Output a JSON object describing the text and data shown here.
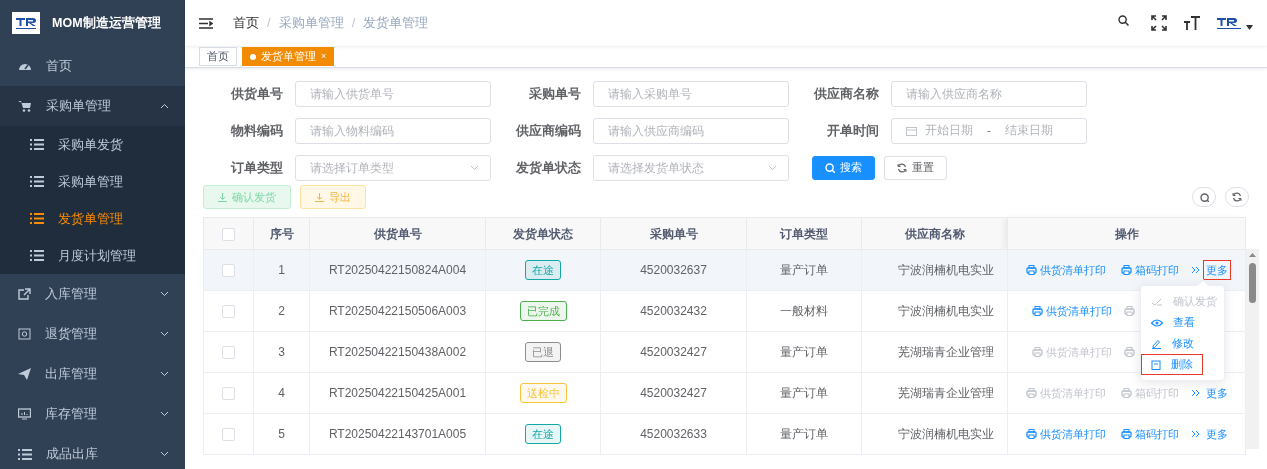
{
  "app": {
    "title": "MOM制造运营管理"
  },
  "sidebar": {
    "items": [
      {
        "kind": "link",
        "label": "首页"
      },
      {
        "kind": "group",
        "label": "采购单管理",
        "expanded": true,
        "children": [
          {
            "label": "采购单发货",
            "selected": false
          },
          {
            "label": "采购单管理",
            "selected": false
          },
          {
            "label": "发货单管理",
            "selected": true
          },
          {
            "label": "月度计划管理",
            "selected": false
          }
        ]
      },
      {
        "kind": "group",
        "label": "入库管理",
        "expanded": false
      },
      {
        "kind": "group",
        "label": "退货管理",
        "expanded": false
      },
      {
        "kind": "group",
        "label": "出库管理",
        "expanded": false
      },
      {
        "kind": "group",
        "label": "库存管理",
        "expanded": false
      },
      {
        "kind": "group",
        "label": "成品出库",
        "expanded": false
      }
    ]
  },
  "breadcrumb": {
    "separator": "/",
    "items": [
      "首页",
      "采购单管理",
      "发货单管理"
    ]
  },
  "tabs": [
    {
      "label": "首页",
      "selected": false
    },
    {
      "label": "发货单管理",
      "selected": true,
      "close": "×"
    }
  ],
  "filters": [
    [
      {
        "kind": "text",
        "label": "供货单号",
        "placeholder": "请输入供货单号"
      },
      {
        "kind": "text",
        "label": "采购单号",
        "placeholder": "请输入采购单号"
      },
      {
        "kind": "text",
        "label": "供应商名称",
        "placeholder": "请输入供应商名称"
      }
    ],
    [
      {
        "kind": "text",
        "label": "物料编码",
        "placeholder": "请输入物料编码"
      },
      {
        "kind": "text",
        "label": "供应商编码",
        "placeholder": "请输入供应商编码"
      },
      {
        "kind": "daterange",
        "label": "开单时间",
        "start_placeholder": "开始日期",
        "separator": "-",
        "end_placeholder": "结束日期"
      }
    ],
    [
      {
        "kind": "select",
        "label": "订单类型",
        "placeholder": "请选择订单类型"
      },
      {
        "kind": "select",
        "label": "发货单状态",
        "placeholder": "请选择发货单状态"
      },
      {
        "kind": "buttons",
        "buttons": [
          {
            "kind": "primary",
            "label": "搜索"
          },
          {
            "kind": "default",
            "label": "重置"
          }
        ]
      }
    ]
  ],
  "toolbar": [
    {
      "kind": "success",
      "label": "确认发货"
    },
    {
      "kind": "warning",
      "label": "导出"
    }
  ],
  "table": {
    "header_checked": false,
    "columns": [
      "序号",
      "供货单号",
      "发货单状态",
      "采购单号",
      "订单类型",
      "供应商名称",
      "操作"
    ],
    "rows": [
      {
        "checked": false,
        "highlighted": true,
        "index": "1",
        "supply_no": "RT20250422150824A004",
        "status": {
          "label": "在途",
          "color": "#13a8a8"
        },
        "po_no": "4520032637",
        "order_type": "量产订单",
        "supplier": "宁波润楠机电实业",
        "actions": [
          {
            "kind": "print",
            "label": "供货清单打印",
            "disabled": false
          },
          {
            "kind": "print",
            "label": "箱码打印",
            "disabled": false
          },
          {
            "kind": "more",
            "label": "更多",
            "disabled": false,
            "highlighted": true
          }
        ]
      },
      {
        "checked": false,
        "highlighted": false,
        "index": "2",
        "supply_no": "RT20250422150506A003",
        "status": {
          "label": "已完成",
          "color": "#4caf50"
        },
        "po_no": "4520032432",
        "order_type": "一般材料",
        "supplier": "宁波润楠机电实业",
        "actions": [
          {
            "kind": "print",
            "label": "供货清单打印",
            "disabled": false
          },
          {
            "kind": "print",
            "disabled": true
          }
        ]
      },
      {
        "checked": false,
        "highlighted": false,
        "index": "3",
        "supply_no": "RT20250422150438A002",
        "status": {
          "label": "已退",
          "color": "#8c8c8c"
        },
        "po_no": "4520032427",
        "order_type": "量产订单",
        "supplier": "芜湖瑞青企业管理",
        "actions": [
          {
            "kind": "print",
            "label": "供货清单打印",
            "disabled": true
          },
          {
            "kind": "print",
            "disabled": true
          }
        ]
      },
      {
        "checked": false,
        "highlighted": false,
        "index": "4",
        "supply_no": "RT20250422150425A001",
        "status": {
          "label": "送检中",
          "color": "#f5c542"
        },
        "po_no": "4520032427",
        "order_type": "量产订单",
        "supplier": "芜湖瑞青企业管理",
        "actions": [
          {
            "kind": "print",
            "label": "供货清单打印",
            "disabled": true
          },
          {
            "kind": "print",
            "label": "箱码打印",
            "disabled": true
          },
          {
            "kind": "more",
            "label": "更多",
            "disabled": false,
            "highlighted": false
          }
        ]
      },
      {
        "checked": false,
        "highlighted": false,
        "index": "5",
        "supply_no": "RT20250422143701A005",
        "status": {
          "label": "在途",
          "color": "#13a8a8"
        },
        "po_no": "4520032633",
        "order_type": "量产订单",
        "supplier": "宁波润楠机电实业",
        "actions": [
          {
            "kind": "print",
            "label": "供货清单打印",
            "disabled": false
          },
          {
            "kind": "print",
            "label": "箱码打印",
            "disabled": false
          },
          {
            "kind": "more",
            "label": "更多",
            "disabled": false,
            "highlighted": false
          }
        ]
      }
    ]
  },
  "more_menu": {
    "items": [
      {
        "kind": "confirm",
        "label": "确认发货",
        "disabled": true,
        "highlighted": false
      },
      {
        "kind": "view",
        "label": "查看",
        "disabled": false,
        "highlighted": false
      },
      {
        "kind": "edit",
        "label": "修改",
        "disabled": false,
        "highlighted": false
      },
      {
        "kind": "delete",
        "label": "删除",
        "disabled": false,
        "highlighted": true
      }
    ]
  }
}
